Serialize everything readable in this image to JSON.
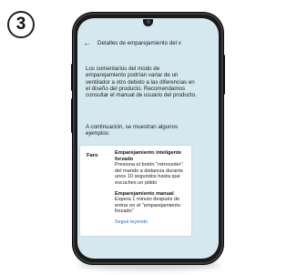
{
  "step": {
    "number": "3"
  },
  "appbar": {
    "title": "Detalles de emparejamiento del v"
  },
  "content": {
    "intro": "Los comentarios del modo de emparejamiento podrían variar de un ventilador a otro debido a las diferencias en el diseño del producto. Recomendamos consultar el manual de usuario del producto.",
    "examples_intro": "A continuación, se muestran algunos ejemplos:",
    "card": {
      "label": "Faro",
      "smart_title": "Emparejamiento inteligente forzado",
      "smart_text": "Presiona el botón \"retroceder\" del mando a distancia durante unos 10 segundos hasta que escuches un pitido",
      "manual_title": "Emparejamiento manual",
      "manual_text": "Espera 1 minuto después de entrar en el \"emparejamiento forzado\"",
      "read_more": "Seguir leyendo"
    }
  },
  "icons": {
    "back": "arrow-left-icon"
  },
  "colors": {
    "screen_bg": "#d5e8ef",
    "link": "#2f6fb5"
  }
}
